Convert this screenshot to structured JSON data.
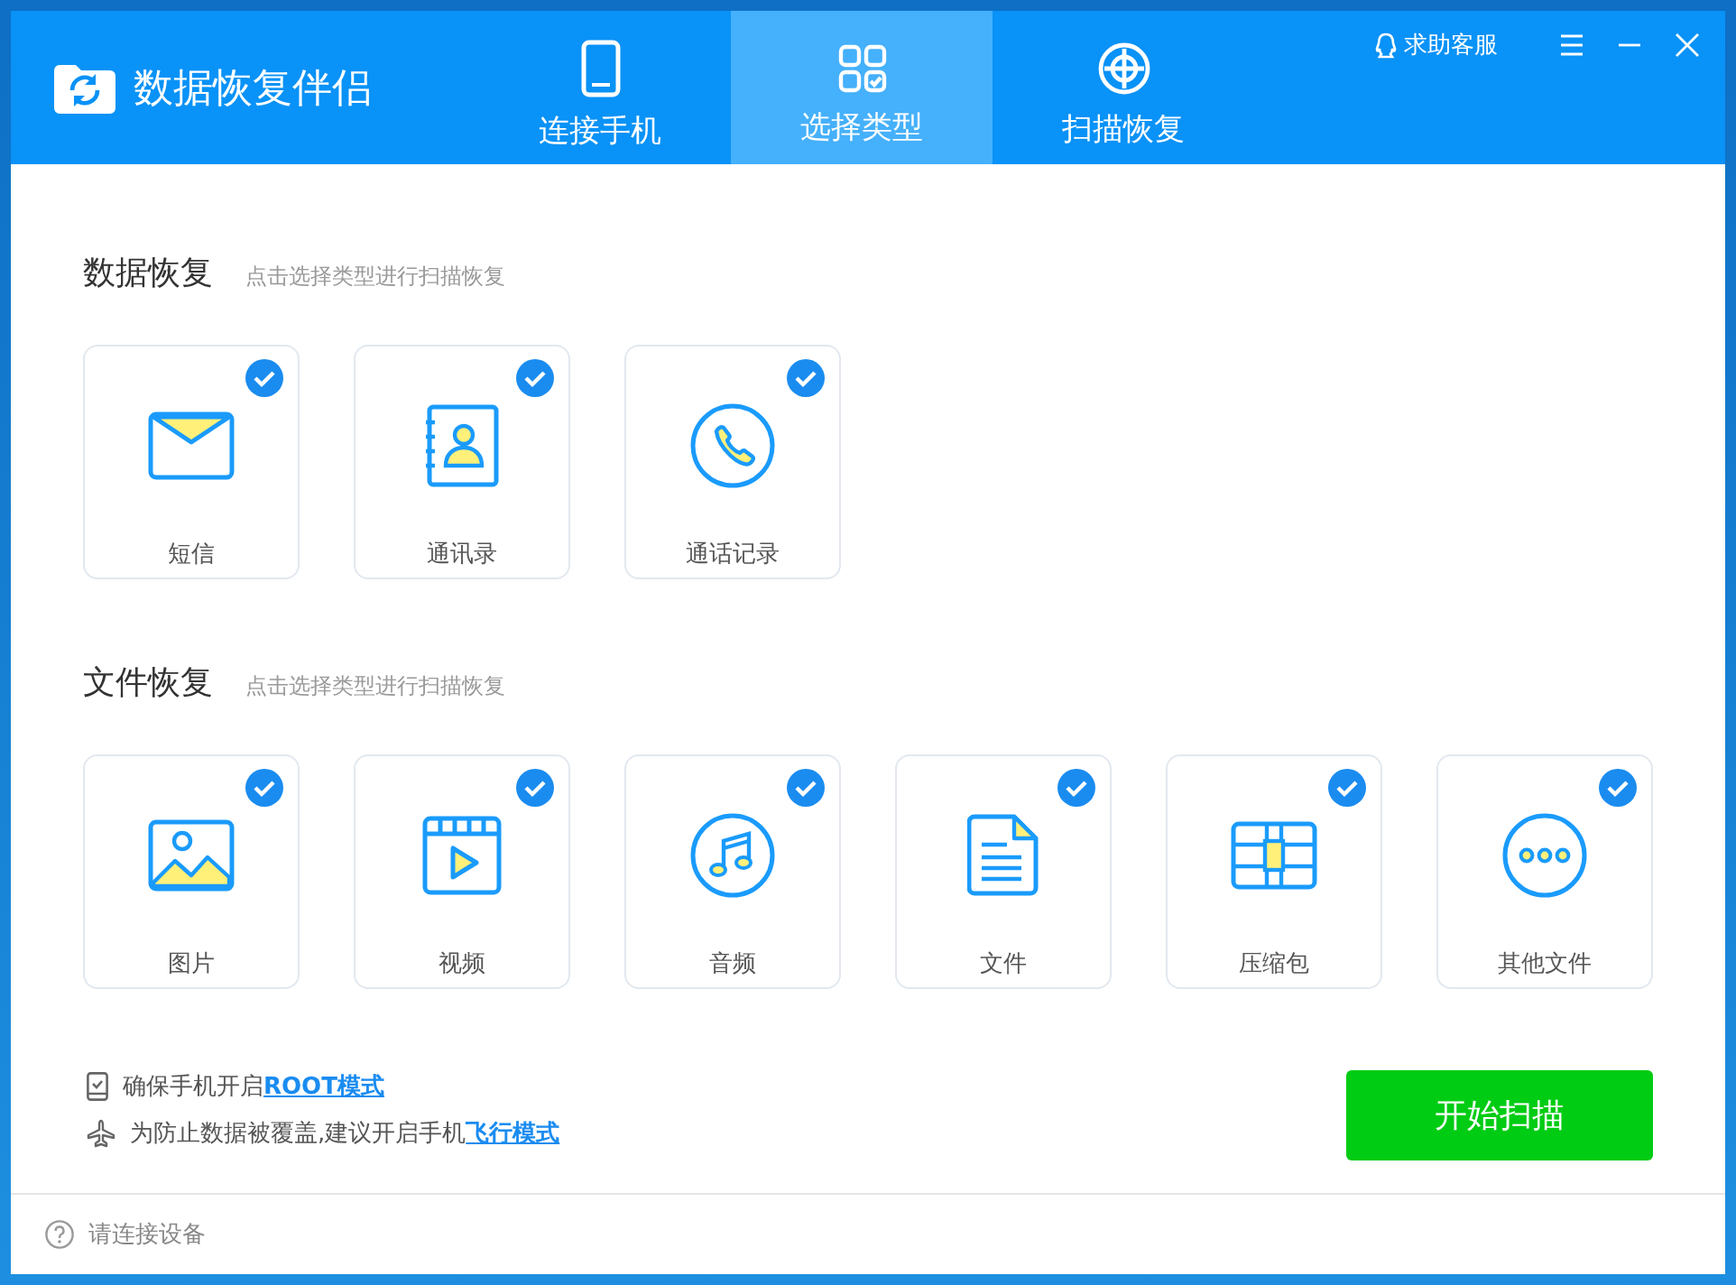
{
  "window": {
    "title": "数据恢复伴侣"
  },
  "header_actions": {
    "help": "求助客服"
  },
  "tabs": [
    {
      "label": "连接手机",
      "kind": "phone",
      "selected": false
    },
    {
      "label": "选择类型",
      "kind": "grid",
      "selected": true
    },
    {
      "label": "扫描恢复",
      "kind": "target",
      "selected": false
    }
  ],
  "sections": [
    {
      "title": "数据恢复",
      "hint": "点击选择类型进行扫描恢复",
      "items": [
        {
          "label": "短信",
          "kind": "message",
          "checked": true
        },
        {
          "label": "通讯录",
          "kind": "contacts",
          "checked": true
        },
        {
          "label": "通话记录",
          "kind": "call",
          "checked": true
        }
      ]
    },
    {
      "title": "文件恢复",
      "hint": "点击选择类型进行扫描恢复",
      "items": [
        {
          "label": "图片",
          "kind": "image",
          "checked": true
        },
        {
          "label": "视频",
          "kind": "video",
          "checked": true
        },
        {
          "label": "音频",
          "kind": "audio",
          "checked": true
        },
        {
          "label": "文件",
          "kind": "document",
          "checked": true
        },
        {
          "label": "压缩包",
          "kind": "archive",
          "checked": true
        },
        {
          "label": "其他文件",
          "kind": "other",
          "checked": true
        }
      ]
    }
  ],
  "tips": [
    {
      "kind": "root",
      "text": "确保手机开启",
      "link": "ROOT模式"
    },
    {
      "kind": "airplane",
      "text": "为防止数据被覆盖,建议开启手机",
      "link": "飞行模式"
    }
  ],
  "start_button": "开始扫描",
  "status_bar": "请连接设备"
}
